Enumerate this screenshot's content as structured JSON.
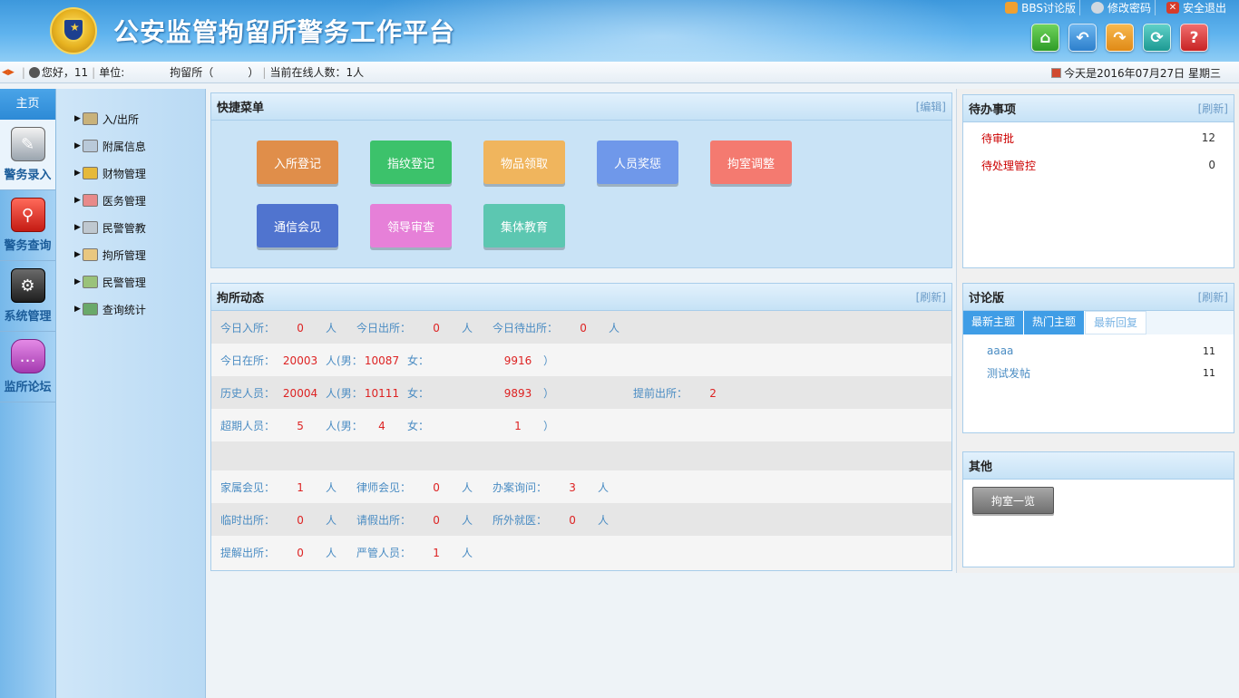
{
  "header": {
    "title": "公安监管拘留所警务工作平台",
    "links": [
      {
        "label": "BBS讨论版",
        "icon": "bbs-icon"
      },
      {
        "label": "修改密码",
        "icon": "gear-icon"
      },
      {
        "label": "安全退出",
        "icon": "close-icon"
      }
    ],
    "nav_buttons": [
      {
        "name": "home-icon",
        "glyph": "⌂"
      },
      {
        "name": "back-arrow-icon",
        "glyph": "↶"
      },
      {
        "name": "forward-arrow-icon",
        "glyph": "↷"
      },
      {
        "name": "refresh-icon",
        "glyph": "⟳"
      },
      {
        "name": "help-icon",
        "glyph": "?"
      }
    ]
  },
  "infobar": {
    "greeting": "您好，11",
    "unit_label": "单位:",
    "unit_value": "拘留所（          ）",
    "online": "当前在线人数：1人",
    "date": "今天是2016年07月27日 星期三"
  },
  "leftnav": {
    "home": "主页",
    "modules": [
      {
        "label": "警务录入",
        "icon": "notepad-icon",
        "cls": "mi-entry",
        "glyph": "✎"
      },
      {
        "label": "警务查询",
        "icon": "magnifier-icon",
        "cls": "mi-query",
        "glyph": "⚲"
      },
      {
        "label": "系统管理",
        "icon": "gear-icon",
        "cls": "mi-sys",
        "glyph": "⚙"
      },
      {
        "label": "监所论坛",
        "icon": "chat-bubble-icon",
        "cls": "mi-forum",
        "glyph": "…"
      }
    ]
  },
  "subnav": [
    {
      "label": "入/出所",
      "icon": "book-icon",
      "color": "#c9b27a"
    },
    {
      "label": "附属信息",
      "icon": "form-icon",
      "color": "#b9c9d9"
    },
    {
      "label": "财物管理",
      "icon": "coins-icon",
      "color": "#e6b93a"
    },
    {
      "label": "医务管理",
      "icon": "pill-icon",
      "color": "#e88a8a"
    },
    {
      "label": "民警管教",
      "icon": "speaker-icon",
      "color": "#bfc8d0"
    },
    {
      "label": "拘所管理",
      "icon": "house-icon",
      "color": "#e9c780"
    },
    {
      "label": "民警管理",
      "icon": "people-icon",
      "color": "#9ac27a"
    },
    {
      "label": "查询统计",
      "icon": "bar-chart-icon",
      "color": "#6aa96a"
    }
  ],
  "quick": {
    "title": "快捷菜单",
    "action": "[编辑]",
    "buttons": [
      {
        "label": "入所登记",
        "color": "#e08e4a"
      },
      {
        "label": "指纹登记",
        "color": "#3cc26b"
      },
      {
        "label": "物品领取",
        "color": "#f0b55d"
      },
      {
        "label": "人员奖惩",
        "color": "#6f98ea"
      },
      {
        "label": "拘室调整",
        "color": "#f47a70"
      },
      {
        "label": "通信会见",
        "color": "#5074cf"
      },
      {
        "label": "领导审查",
        "color": "#e680d8"
      },
      {
        "label": "集体教育",
        "color": "#5cc7b1"
      }
    ]
  },
  "dynamics": {
    "title": "拘所动态",
    "action": "[刷新]",
    "rows": [
      [
        {
          "t": "今日入所：",
          "n": "0",
          "u": "人"
        },
        {
          "t": "今日出所：",
          "n": "0",
          "u": "人"
        },
        {
          "t": "今日待出所：",
          "n": "0",
          "u": "人"
        }
      ],
      [
        {
          "t": "今日在所：",
          "n": "20003",
          "u": "人(男："
        },
        {
          "t": "",
          "n": "10087",
          "u": "女："
        },
        {
          "t": "",
          "n": "9916",
          "u": "）"
        }
      ],
      [
        {
          "t": "历史人员：",
          "n": "20004",
          "u": "人(男："
        },
        {
          "t": "",
          "n": "10111",
          "u": "女："
        },
        {
          "t": "",
          "n": "9893",
          "u": "）"
        },
        {
          "t": "提前出所：",
          "n": "2",
          "u": ""
        }
      ],
      [
        {
          "t": "超期人员：",
          "n": "5",
          "u": "人(男："
        },
        {
          "t": "",
          "n": "4",
          "u": "女："
        },
        {
          "t": "",
          "n": "1",
          "u": "）"
        }
      ],
      [],
      [
        {
          "t": "家属会见：",
          "n": "1",
          "u": "人"
        },
        {
          "t": "律师会见：",
          "n": "0",
          "u": "人"
        },
        {
          "t": "办案询问：",
          "n": "3",
          "u": "人"
        }
      ],
      [
        {
          "t": "临时出所：",
          "n": "0",
          "u": "人"
        },
        {
          "t": "请假出所：",
          "n": "0",
          "u": "人"
        },
        {
          "t": "所外就医：",
          "n": "0",
          "u": "人"
        }
      ],
      [
        {
          "t": "提解出所：",
          "n": "0",
          "u": "人"
        },
        {
          "t": "严管人员：",
          "n": "1",
          "u": "人"
        }
      ]
    ]
  },
  "todo": {
    "title": "待办事项",
    "action": "[刷新]",
    "items": [
      {
        "label": "待审批",
        "count": "12"
      },
      {
        "label": "待处理管控",
        "count": "0"
      }
    ]
  },
  "forum": {
    "title": "讨论版",
    "action": "[刷新]",
    "tabs": [
      "最新主题",
      "热门主题",
      "最新回复"
    ],
    "posts": [
      {
        "title": "aaaa",
        "count": "11"
      },
      {
        "title": "测试发帖",
        "count": "11"
      }
    ]
  },
  "other": {
    "title": "其他",
    "button": "拘室一览"
  }
}
